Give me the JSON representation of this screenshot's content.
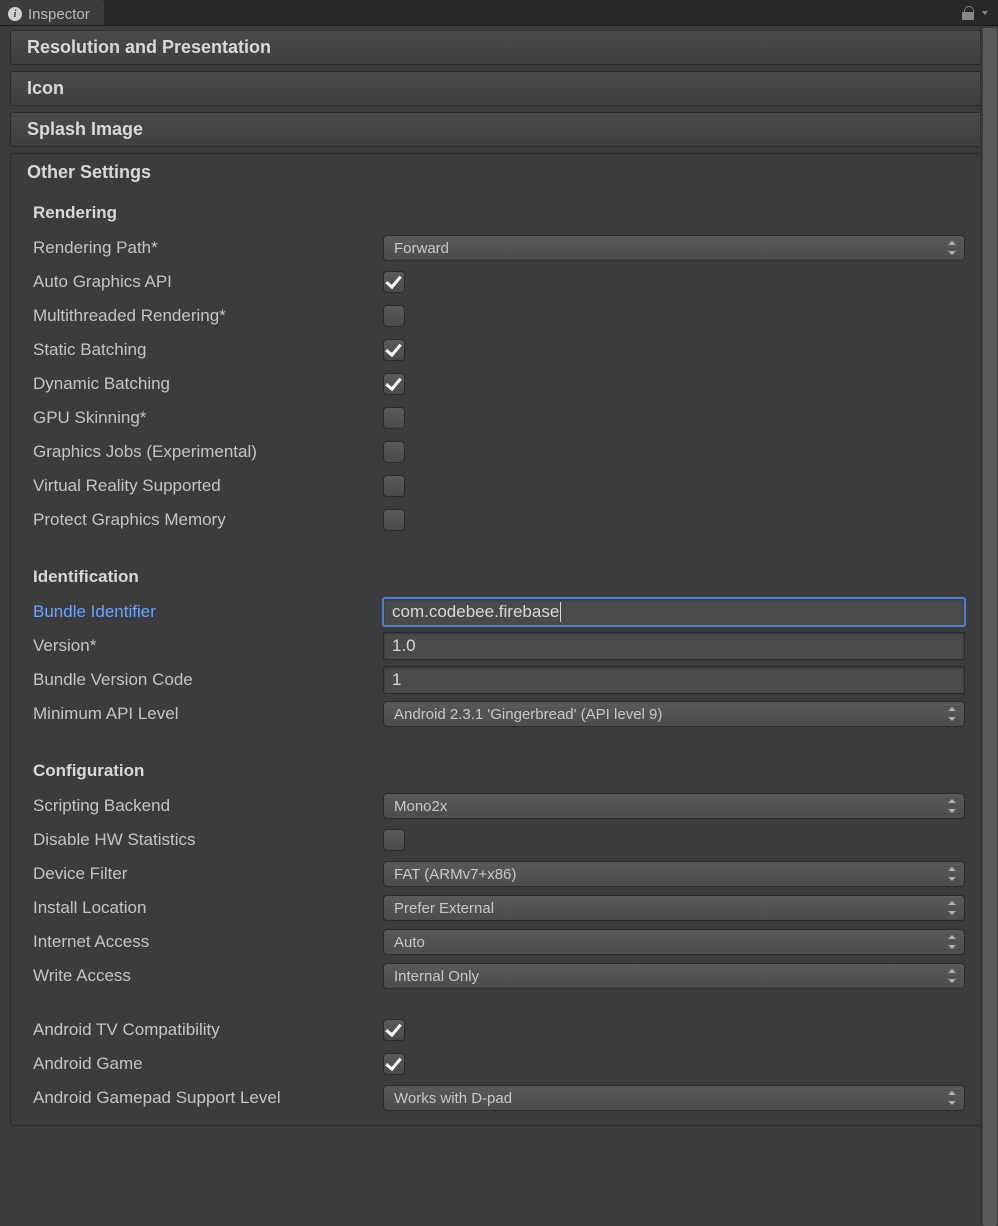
{
  "tab": {
    "title": "Inspector"
  },
  "sections": {
    "resolution": "Resolution and Presentation",
    "icon": "Icon",
    "splash": "Splash Image",
    "other": "Other Settings"
  },
  "rendering": {
    "heading": "Rendering",
    "path_label": "Rendering Path*",
    "path_value": "Forward",
    "auto_gfx_label": "Auto Graphics API",
    "multithreaded_label": "Multithreaded Rendering*",
    "static_batching_label": "Static Batching",
    "dynamic_batching_label": "Dynamic Batching",
    "gpu_skinning_label": "GPU Skinning*",
    "graphics_jobs_label": "Graphics Jobs (Experimental)",
    "vr_supported_label": "Virtual Reality Supported",
    "protect_memory_label": "Protect Graphics Memory"
  },
  "identification": {
    "heading": "Identification",
    "bundle_id_label": "Bundle Identifier",
    "bundle_id_value": "com.codebee.firebase",
    "version_label": "Version*",
    "version_value": "1.0",
    "bundle_code_label": "Bundle Version Code",
    "bundle_code_value": "1",
    "min_api_label": "Minimum API Level",
    "min_api_value": "Android 2.3.1 'Gingerbread' (API level 9)"
  },
  "configuration": {
    "heading": "Configuration",
    "scripting_backend_label": "Scripting Backend",
    "scripting_backend_value": "Mono2x",
    "disable_hw_label": "Disable HW Statistics",
    "device_filter_label": "Device Filter",
    "device_filter_value": "FAT (ARMv7+x86)",
    "install_location_label": "Install Location",
    "install_location_value": "Prefer External",
    "internet_access_label": "Internet Access",
    "internet_access_value": "Auto",
    "write_access_label": "Write Access",
    "write_access_value": "Internal Only",
    "android_tv_label": "Android TV Compatibility",
    "android_game_label": "Android Game",
    "gamepad_level_label": "Android Gamepad Support Level",
    "gamepad_level_value": "Works with D-pad"
  }
}
